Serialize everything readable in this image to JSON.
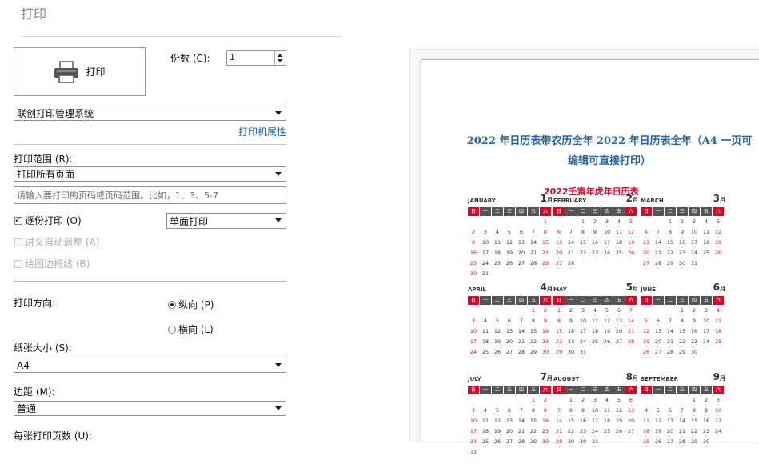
{
  "dialog": {
    "title": "打印"
  },
  "print_button": {
    "label": "打印",
    "icon": "printer-icon"
  },
  "copies": {
    "label": "份数 (C):",
    "value": "1"
  },
  "printer": {
    "selected": "联创打印管理系统",
    "properties_link": "打印机属性"
  },
  "range": {
    "label": "打印范围 (R):",
    "selected": "打印所有页面",
    "placeholder": "请输入要打印的页码或页码范围。比如，1、3、5-7"
  },
  "collate": {
    "label": "逐份打印 (O)",
    "checked": true
  },
  "duplex": {
    "selected": "单面打印"
  },
  "handout_auto": {
    "label": "讲义自动调整 (A)"
  },
  "draw_border": {
    "label": "绘图边框线 (B)"
  },
  "orientation": {
    "label": "打印方向:",
    "portrait": "纵向 (P)",
    "landscape": "横向 (L)",
    "selected": "portrait"
  },
  "paper_size": {
    "label": "纸张大小 (S):",
    "selected": "A4"
  },
  "margin": {
    "label": "边距 (M):",
    "selected": "普通"
  },
  "pages_per_sheet": {
    "label": "每张打印页数 (U):"
  },
  "preview": {
    "doc_title_line1": "2022 年日历表带农历全年 2022 年日历表全年（A4 一页可",
    "doc_title_line2": "编辑可直接打印）",
    "calendar_title": "2022壬寅年虎年日历表",
    "weekdays": [
      "日",
      "一",
      "二",
      "三",
      "四",
      "五",
      "六"
    ],
    "month_suffix": "月",
    "months": [
      {
        "name": "JANUARY",
        "num": "1",
        "start": 6,
        "days": 31
      },
      {
        "name": "FEBRUARY",
        "num": "2",
        "start": 2,
        "days": 28
      },
      {
        "name": "MARCH",
        "num": "3",
        "start": 2,
        "days": 31
      },
      {
        "name": "APRIL",
        "num": "4",
        "start": 5,
        "days": 30
      },
      {
        "name": "MAY",
        "num": "5",
        "start": 0,
        "days": 31
      },
      {
        "name": "JUNE",
        "num": "6",
        "start": 3,
        "days": 30
      },
      {
        "name": "JULY",
        "num": "7",
        "start": 5,
        "days": 31
      },
      {
        "name": "AUGUST",
        "num": "8",
        "start": 1,
        "days": 31
      },
      {
        "name": "SEPTEMBER",
        "num": "9",
        "start": 4,
        "days": 30
      }
    ]
  },
  "colors": {
    "link": "#1f5fa6",
    "calendar_red": "#c8102e",
    "title_blue": "#2a6496"
  }
}
